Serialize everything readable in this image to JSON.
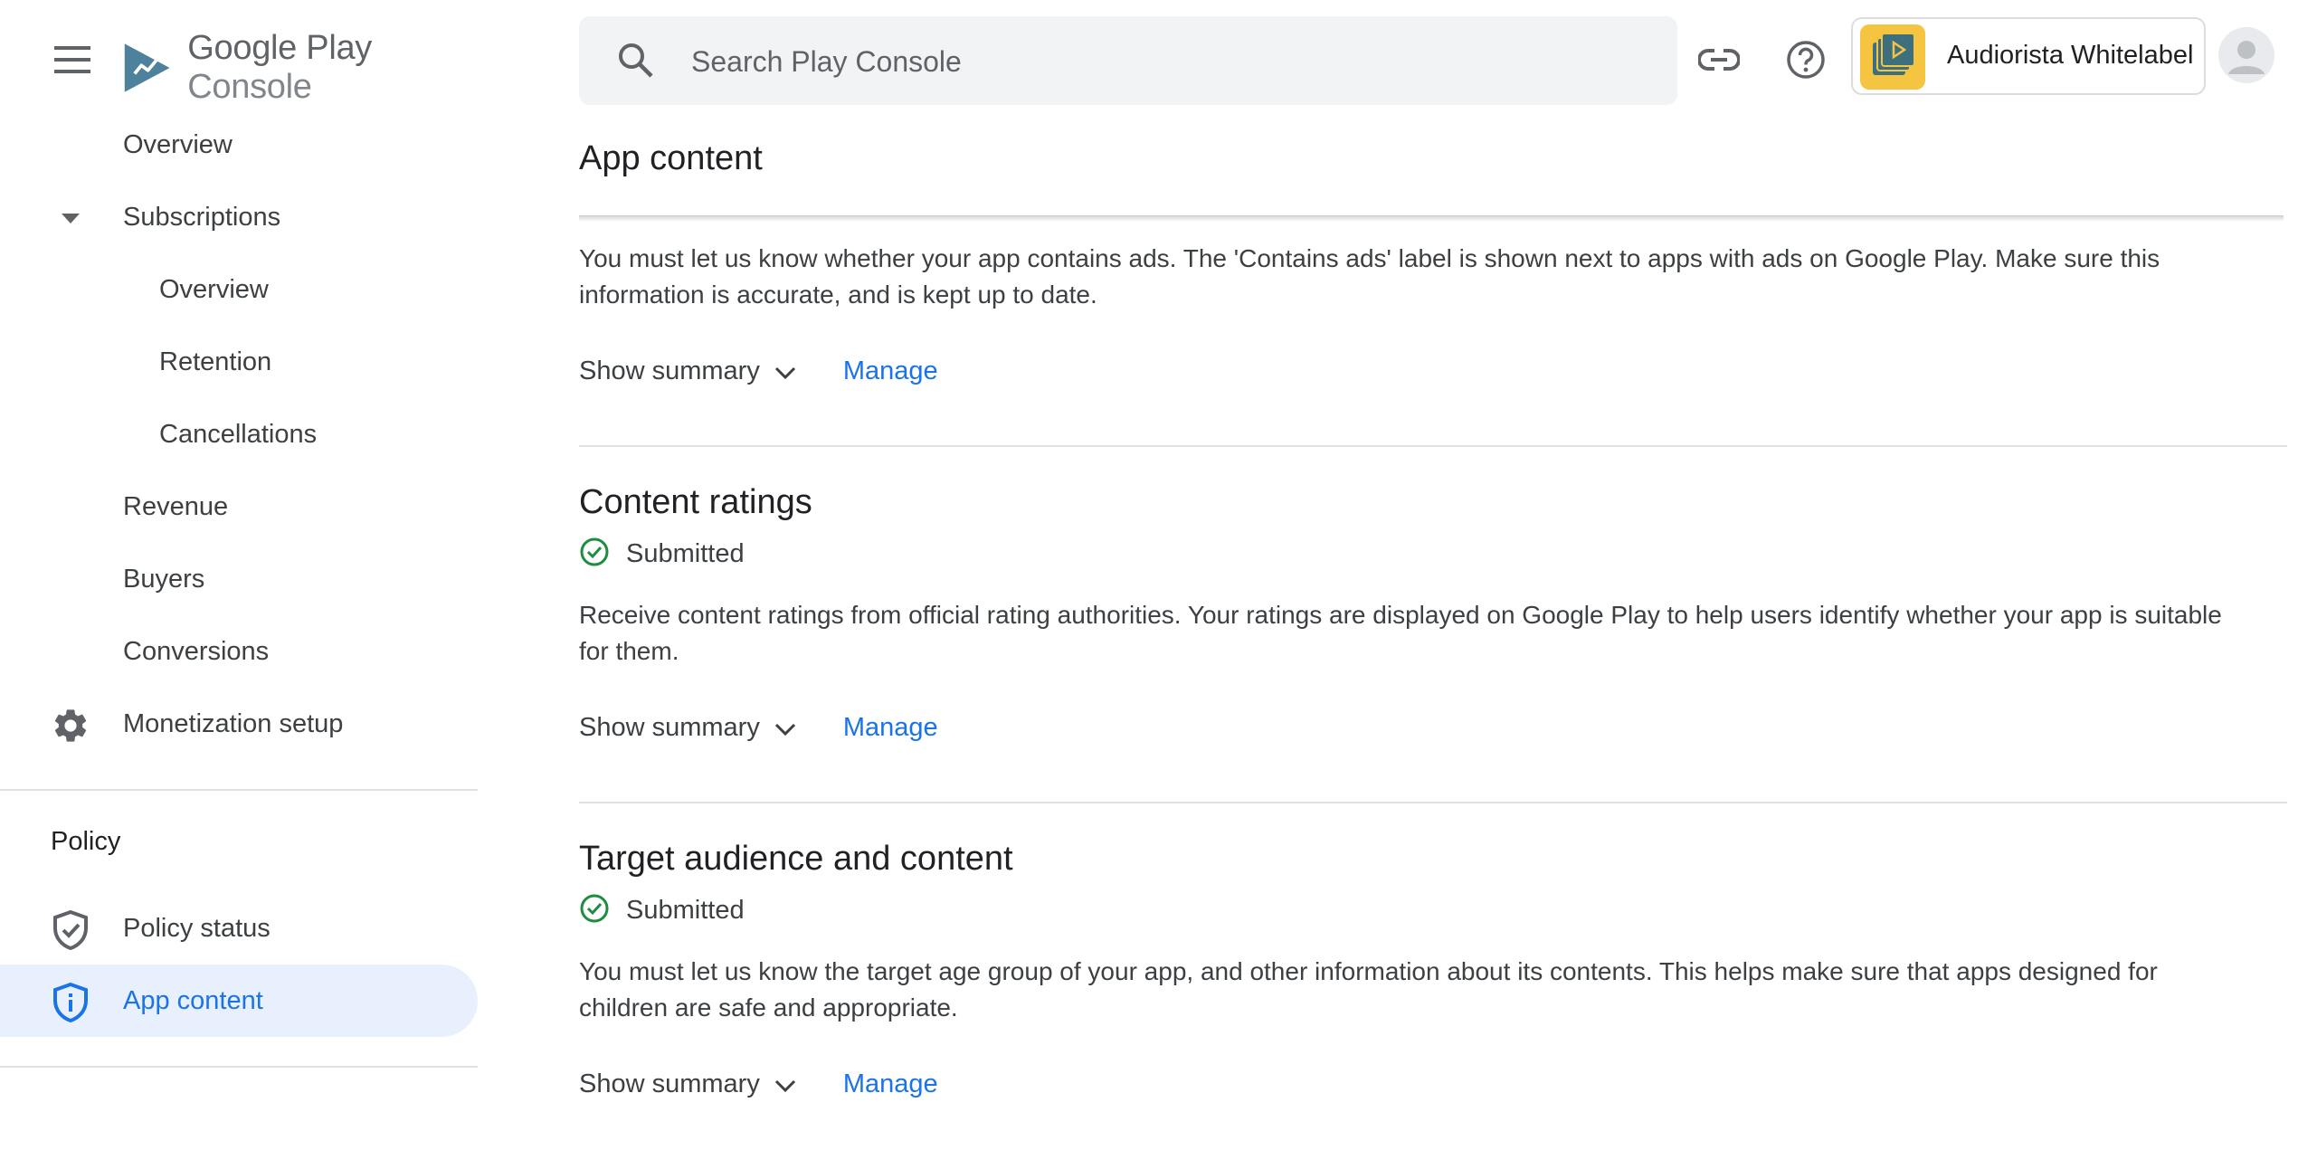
{
  "header": {
    "logo_text_main": "Google Play",
    "logo_text_sub": "Console",
    "search_placeholder": "Search Play Console",
    "app_name": "Audiorista Whitelabel"
  },
  "sidebar": {
    "items": [
      {
        "label": "Overview"
      },
      {
        "label": "Subscriptions"
      },
      {
        "label": "Overview"
      },
      {
        "label": "Retention"
      },
      {
        "label": "Cancellations"
      },
      {
        "label": "Revenue"
      },
      {
        "label": "Buyers"
      },
      {
        "label": "Conversions"
      },
      {
        "label": "Monetization setup",
        "icon": "gear-icon"
      }
    ],
    "policy_section_title": "Policy",
    "policy_items": [
      {
        "label": "Policy status",
        "icon": "shield-check-icon"
      },
      {
        "label": "App content",
        "icon": "shield-info-icon",
        "active": true
      }
    ]
  },
  "main": {
    "page_title": "App content",
    "sections": [
      {
        "description": "You must let us know whether your app contains ads. The 'Contains ads' label is shown next to apps with ads on Google Play. Make sure this information is accurate, and is kept up to date.",
        "show_summary": "Show summary",
        "manage": "Manage"
      },
      {
        "title": "Content ratings",
        "status": "Submitted",
        "description": "Receive content ratings from official rating authorities. Your ratings are displayed on Google Play to help users identify whether your app is suitable for them.",
        "show_summary": "Show summary",
        "manage": "Manage"
      },
      {
        "title": "Target audience and content",
        "status": "Submitted",
        "description": "You must let us know the target age group of your app, and other information about its contents. This helps make sure that apps designed for children are safe and appropriate.",
        "show_summary": "Show summary",
        "manage": "Manage"
      }
    ]
  },
  "colors": {
    "accent": "#1a73e8",
    "active_bg": "#e8f0fe",
    "success": "#1e8e3e",
    "app_icon_bg": "#f5c542"
  }
}
